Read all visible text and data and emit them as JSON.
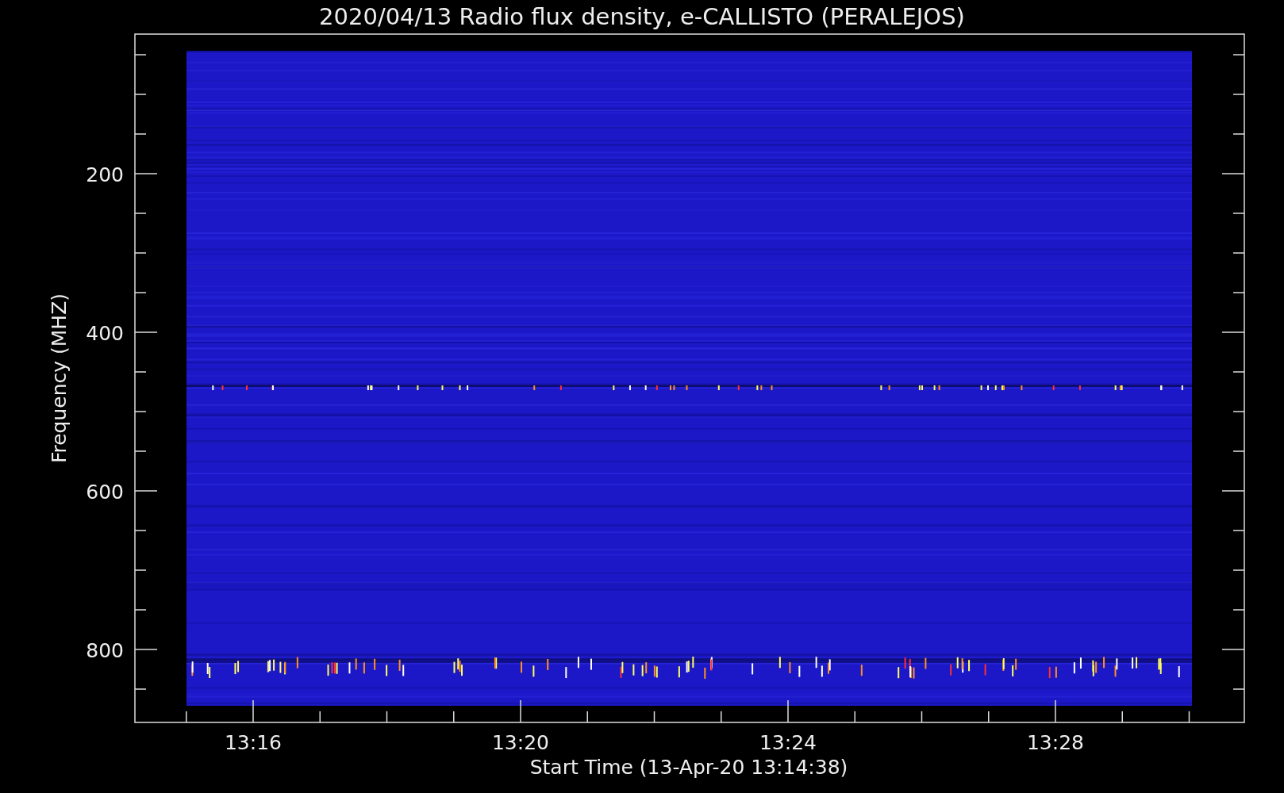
{
  "title": "2020/04/13  Radio flux density, e-CALLISTO (PERALEJOS)",
  "x_axis": {
    "label": "Start Time (13-Apr-20 13:14:38)",
    "ticks": [
      "13:16",
      "13:20",
      "13:24",
      "13:28"
    ]
  },
  "y_axis": {
    "label": "Frequency (MHZ)",
    "ticks": [
      "200",
      "400",
      "600",
      "800"
    ]
  }
}
